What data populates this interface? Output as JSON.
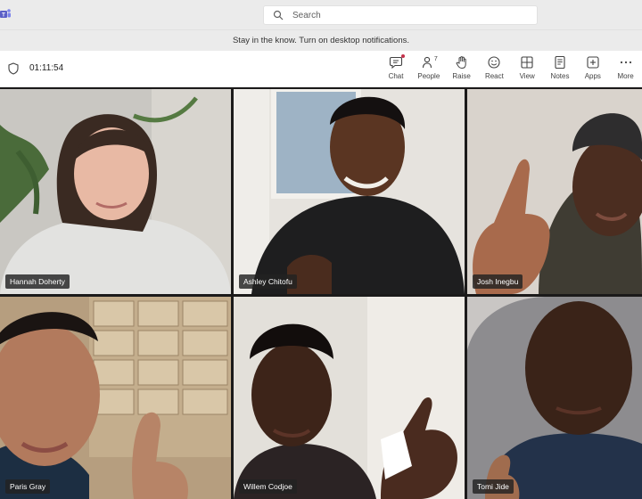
{
  "app": {
    "logo_icon": "teams-logo-icon",
    "accent_color": "#5b5fc7"
  },
  "search": {
    "placeholder": "Search",
    "icon": "search-icon"
  },
  "banner": {
    "text": "Stay in the know. Turn on desktop notifications."
  },
  "meeting": {
    "timer": "01:11:54",
    "people_count": "7"
  },
  "toolbar": {
    "items": [
      {
        "label": "Chat",
        "icon": "chat-icon"
      },
      {
        "label": "People",
        "icon": "people-icon"
      },
      {
        "label": "Raise",
        "icon": "raise-hand-icon"
      },
      {
        "label": "React",
        "icon": "react-icon"
      },
      {
        "label": "View",
        "icon": "view-icon"
      },
      {
        "label": "Notes",
        "icon": "notes-icon"
      },
      {
        "label": "Apps",
        "icon": "apps-icon"
      },
      {
        "label": "More",
        "icon": "more-icon"
      }
    ]
  },
  "participants": [
    {
      "name": "Hannah Doherty"
    },
    {
      "name": "Ashley Chitofu"
    },
    {
      "name": "Josh Inegbu"
    },
    {
      "name": "Paris Gray"
    },
    {
      "name": "Willem Codjoe"
    },
    {
      "name": "Tomi Jide"
    }
  ]
}
